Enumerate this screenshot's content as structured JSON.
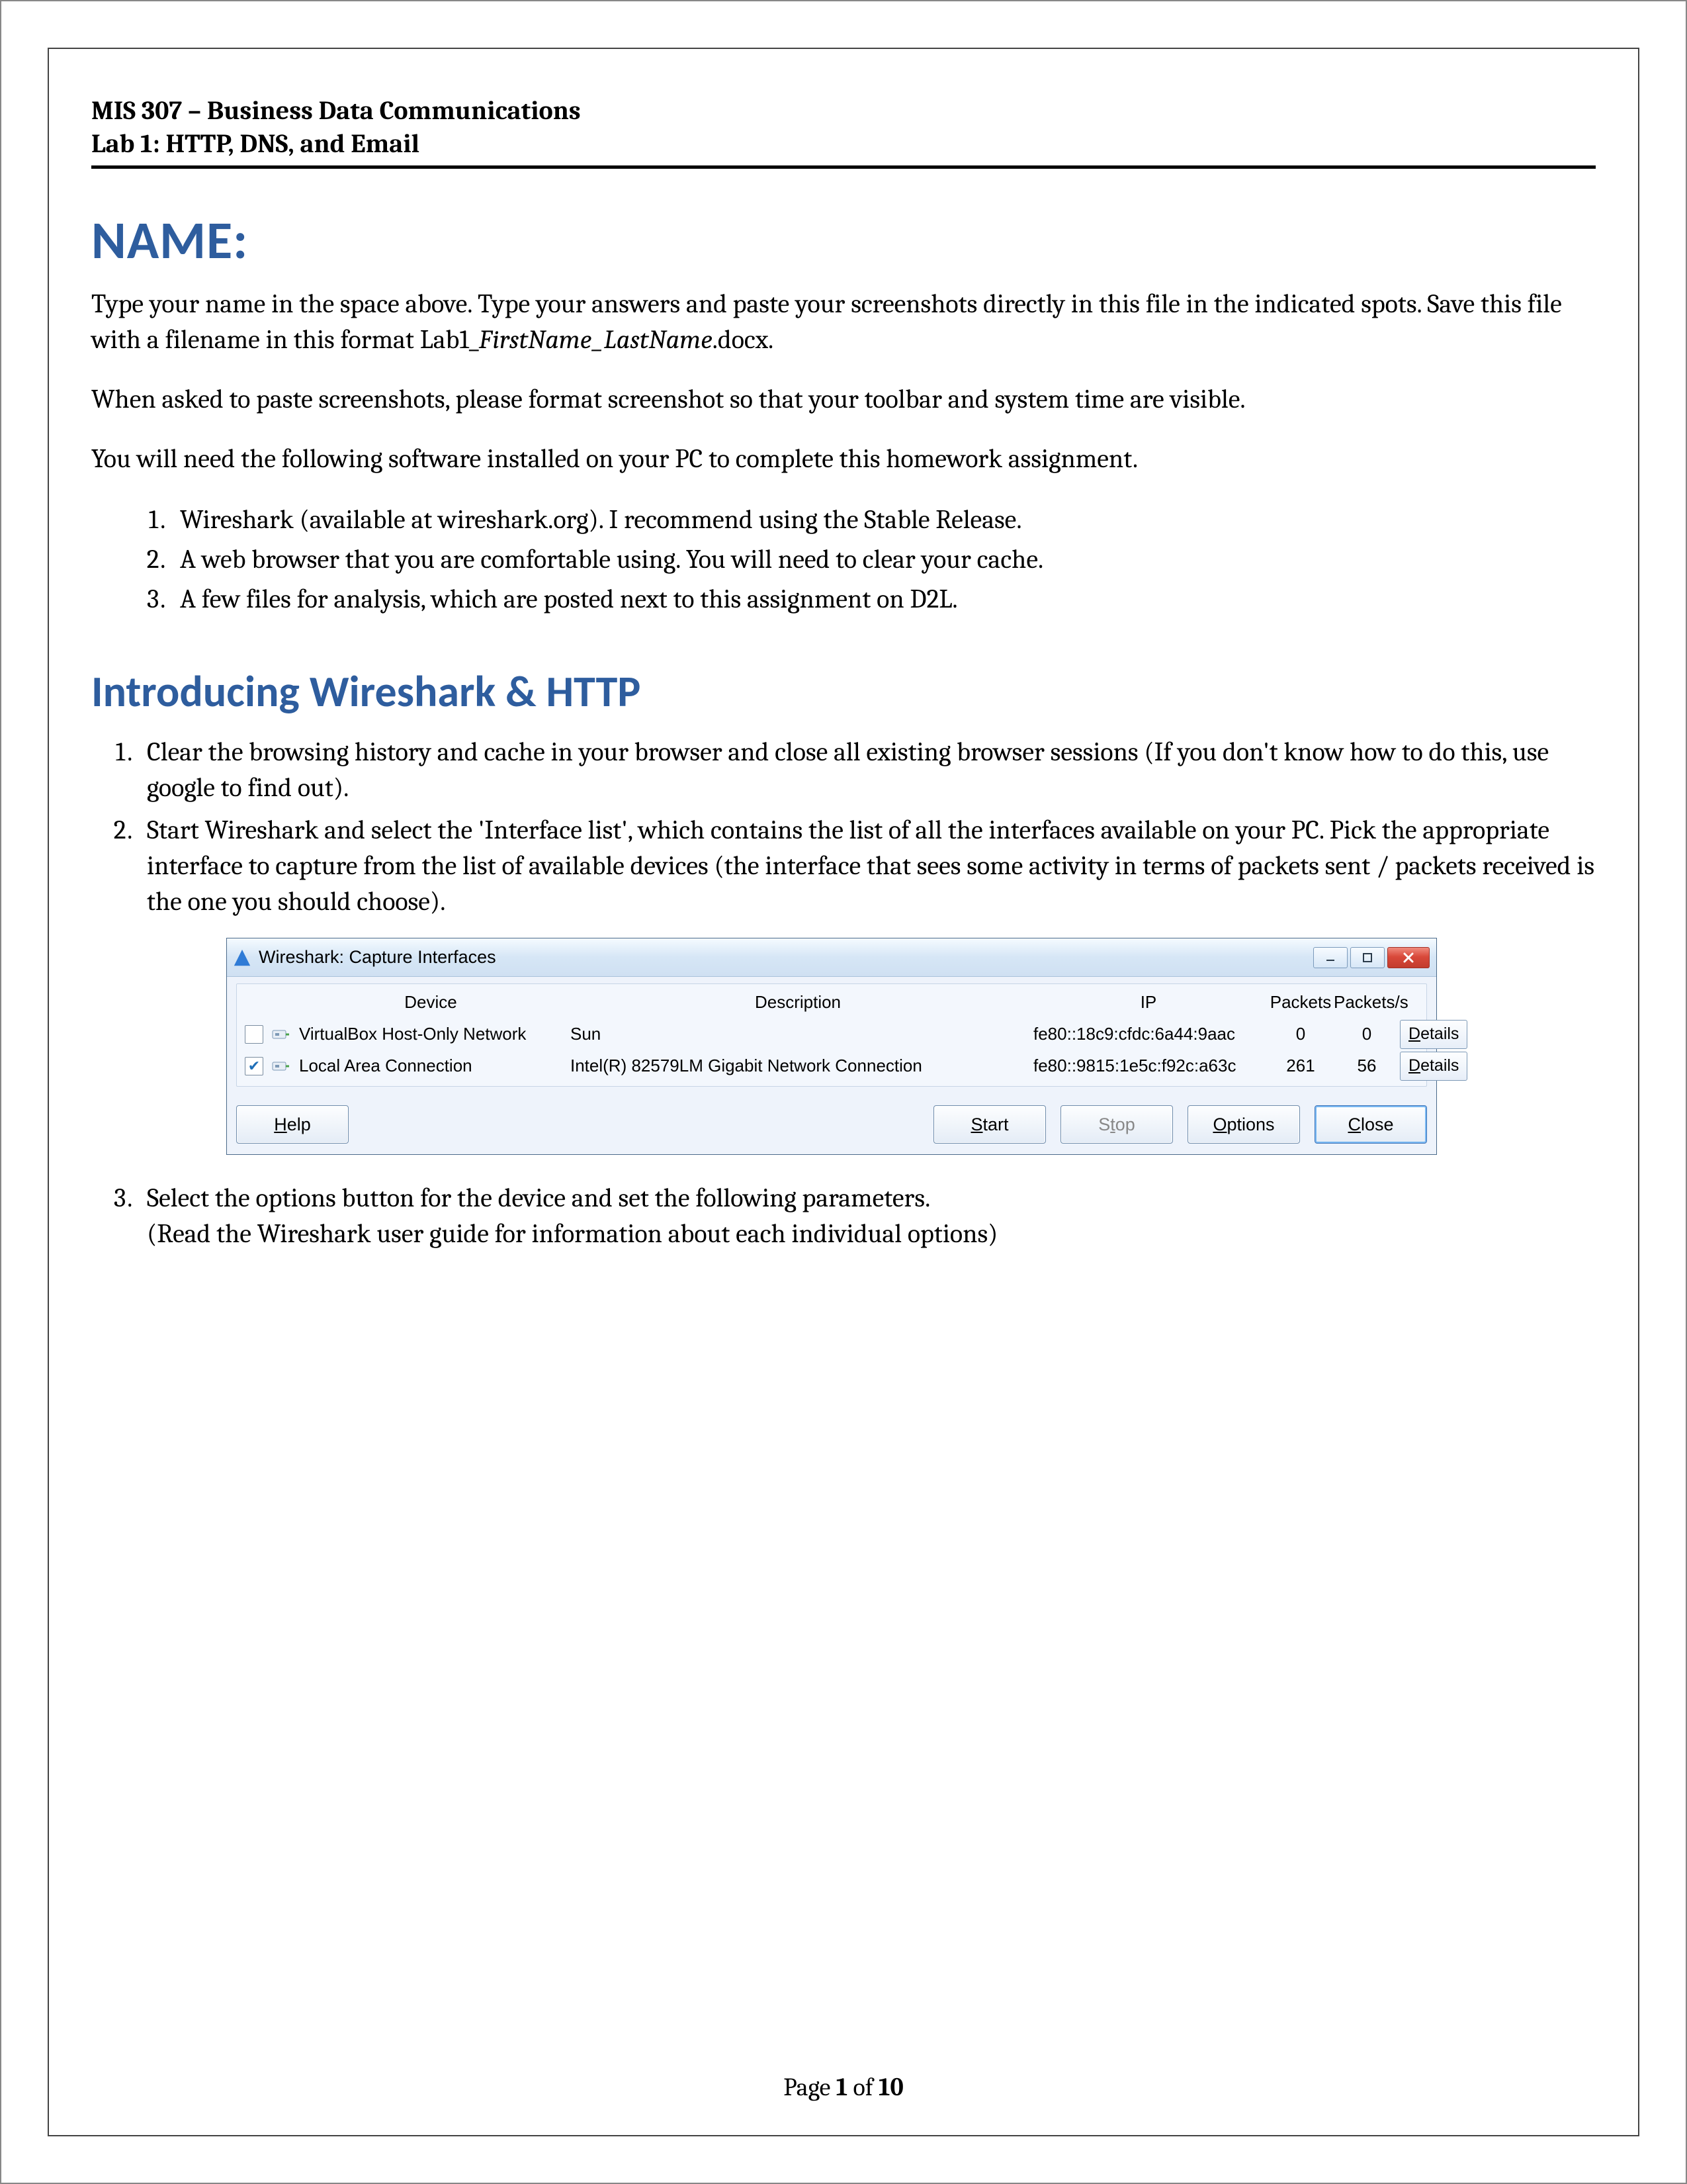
{
  "header": {
    "line1": "MIS 307 – Business Data Communications",
    "line2": "Lab 1: HTTP, DNS, and Email"
  },
  "nameHeading": "NAME:",
  "intro1a": "Type your name in the space above.  Type your answers and paste your screenshots directly in this file in the indicated spots. Save this file with a filename in this format Lab1_",
  "intro1_italic": "FirstName_LastName",
  "intro1b": ".docx.",
  "intro2": "When asked to paste screenshots, please format screenshot so that your toolbar and system time are visible.",
  "intro3": "You will need the following software installed on your PC to complete this homework assignment.",
  "software": [
    "Wireshark (available at wireshark.org).  I recommend using the Stable Release.",
    "A web browser that you are comfortable using. You will need to clear your cache.",
    "A few files for analysis, which are posted next to this assignment on D2L."
  ],
  "sectionHeading": "Introducing Wireshark & HTTP",
  "steps": {
    "s1": "Clear the browsing history and cache in your browser and close all existing browser sessions (If you don't know how to do this, use google to find out).",
    "s2": "Start Wireshark and select the 'Interface list', which contains the list of all the interfaces available on your PC. Pick the appropriate interface to capture from the list of available devices (the interface that sees some activity in terms of packets sent / packets received is the one you should choose).",
    "s3a": "Select the options button for the device and set the following parameters.",
    "s3b": "(Read the Wireshark user guide for information about each individual options)"
  },
  "wireshark": {
    "title": "Wireshark: Capture Interfaces",
    "columns": {
      "device": "Device",
      "description": "Description",
      "ip": "IP",
      "packets": "Packets",
      "packetss": "Packets/s"
    },
    "rows": [
      {
        "checked": false,
        "device": "VirtualBox Host-Only Network",
        "description": "Sun",
        "ip": "fe80::18c9:cfdc:6a44:9aac",
        "packets": "0",
        "packetss": "0"
      },
      {
        "checked": true,
        "device": "Local Area Connection",
        "description": "Intel(R) 82579LM Gigabit Network Connection",
        "ip": "fe80::9815:1e5c:f92c:a63c",
        "packets": "261",
        "packetss": "56"
      }
    ],
    "detailsLabel": "Details",
    "buttons": {
      "help": "Help",
      "start": "Start",
      "stop": "Stop",
      "options": "Options",
      "close": "Close"
    }
  },
  "footer": {
    "prefix": "Page ",
    "num": "1",
    "of": " of ",
    "total": "10"
  }
}
